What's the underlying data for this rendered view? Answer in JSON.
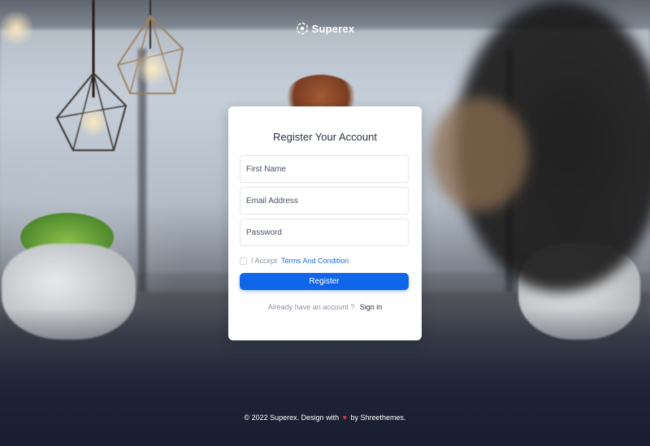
{
  "brand": {
    "name": "Superex",
    "logo_icon": "superex-logo-icon"
  },
  "register_form": {
    "title": "Register Your Account",
    "first_name_placeholder": "First Name",
    "email_placeholder": "Email Address",
    "password_placeholder": "Password",
    "terms_prefix": "I Accept",
    "terms_link": "Terms And Condition",
    "terms_checked": false,
    "register_label": "Register",
    "signin_prompt": "Already have an account ?",
    "signin_link": "Sign in"
  },
  "footer": {
    "copyright_prefix": "© 2022 Superex. Design with",
    "heart_icon": "heart-icon",
    "by_text": "by Shreethemes."
  },
  "colors": {
    "primary": "#1066e8",
    "link": "#1a6fe8",
    "heart": "#e03b3b",
    "card_bg": "#ffffff"
  }
}
